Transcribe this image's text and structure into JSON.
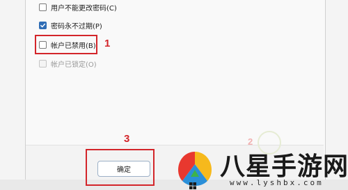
{
  "options": [
    {
      "label": "用户不能更改密码(C)",
      "checked": false,
      "disabled": false
    },
    {
      "label": "密码永不过期(P)",
      "checked": true,
      "disabled": false
    },
    {
      "label": "帐户已禁用(B)",
      "checked": false,
      "disabled": false
    },
    {
      "label": "帐户已锁定(O)",
      "checked": false,
      "disabled": true
    }
  ],
  "ok_button": {
    "label": "确定"
  },
  "annotations": {
    "step1": "1",
    "step2": "2",
    "step3": "3"
  },
  "watermark": {
    "title": "八星手游网",
    "url": "www.lyshbx.com"
  },
  "colors": {
    "highlight": "#d3252a",
    "checkbox_checked": "#2f6db5"
  }
}
